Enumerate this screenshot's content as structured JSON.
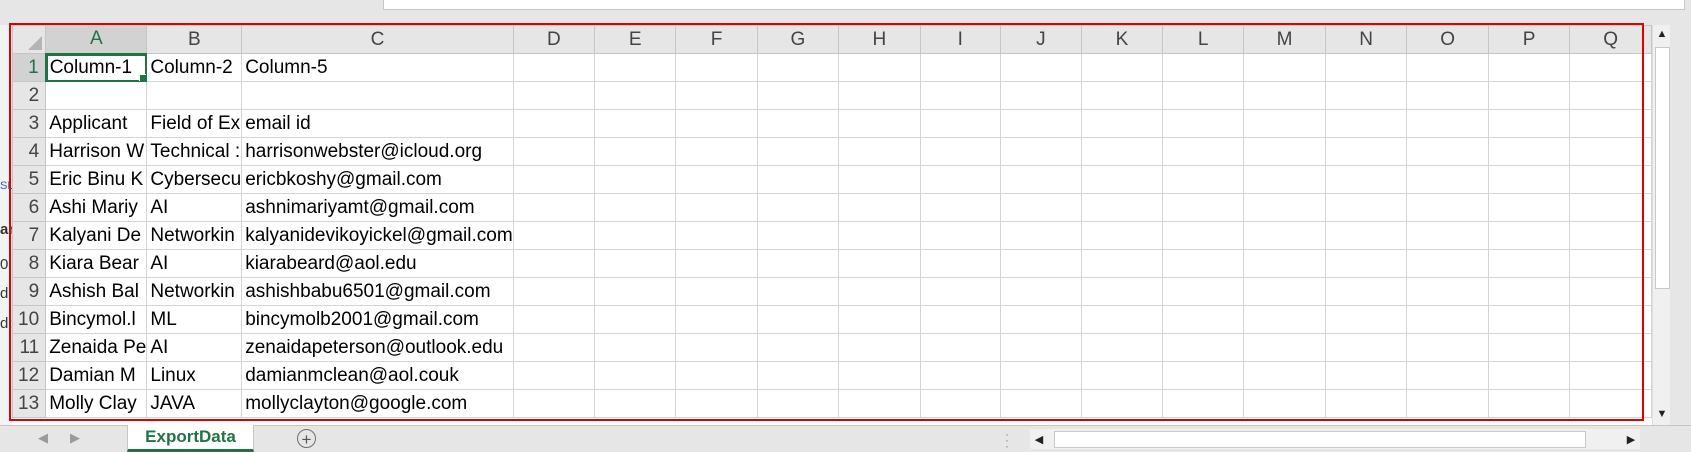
{
  "columns": [
    "A",
    "B",
    "C",
    "D",
    "E",
    "F",
    "G",
    "H",
    "I",
    "J",
    "K",
    "L",
    "M",
    "N",
    "O",
    "P",
    "Q"
  ],
  "rows": [
    {
      "num": "1",
      "cells": [
        "Column-1",
        "Column-2",
        "Column-5"
      ]
    },
    {
      "num": "2",
      "cells": [
        "",
        "",
        ""
      ]
    },
    {
      "num": "3",
      "cells": [
        "Applicant",
        "Field of Ex",
        "email id"
      ]
    },
    {
      "num": "4",
      "cells": [
        "Harrison W",
        "Technical :",
        "harrisonwebster@icloud.org"
      ]
    },
    {
      "num": "5",
      "cells": [
        "Eric Binu K",
        "Cybersecu",
        "ericbkoshy@gmail.com"
      ]
    },
    {
      "num": "6",
      "cells": [
        "Ashi Mariy",
        "AI",
        "ashnimariyamt@gmail.com"
      ]
    },
    {
      "num": "7",
      "cells": [
        "Kalyani De",
        "Networkin",
        "kalyanidevikoyickel@gmail.com"
      ]
    },
    {
      "num": "8",
      "cells": [
        "Kiara Bear",
        "AI",
        "kiarabeard@aol.edu"
      ]
    },
    {
      "num": "9",
      "cells": [
        "Ashish Bal",
        "Networkin",
        "ashishbabu6501@gmail.com"
      ]
    },
    {
      "num": "10",
      "cells": [
        "Bincymol.l",
        "ML",
        "bincymolb2001@gmail.com"
      ]
    },
    {
      "num": "11",
      "cells": [
        "Zenaida Pe",
        "AI",
        "zenaidapeterson@outlook.edu"
      ]
    },
    {
      "num": "12",
      "cells": [
        "Damian M",
        "Linux",
        "damianmclean@aol.couk"
      ]
    },
    {
      "num": "13",
      "cells": [
        "Molly Clay",
        "JAVA",
        "mollyclayton@google.com"
      ]
    }
  ],
  "sheet_tab": "ExportData",
  "add_sheet_label": "+",
  "left_fragments": [
    "SL",
    "ar",
    "0",
    "d",
    "d:"
  ],
  "scroll": {
    "up": "▲",
    "down": "▼",
    "left": "◀",
    "right": "▶"
  },
  "nav": {
    "prev": "◀",
    "next": "▶"
  },
  "colors": {
    "accent": "#217346",
    "highlight": "#e00000"
  }
}
